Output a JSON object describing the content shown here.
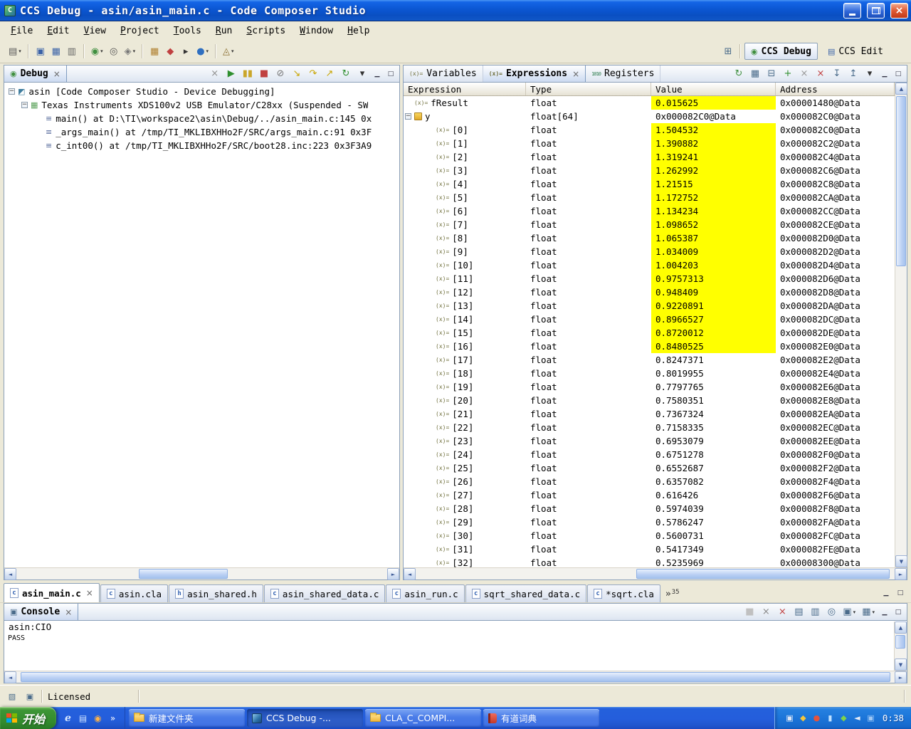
{
  "window": {
    "title": "CCS Debug - asin/asin_main.c - Code Composer Studio"
  },
  "menu": {
    "items": [
      "File",
      "Edit",
      "View",
      "Project",
      "Tools",
      "Run",
      "Scripts",
      "Window",
      "Help"
    ]
  },
  "main_toolbar": {
    "items": [
      {
        "name": "new-button",
        "glyph": "▤",
        "color": "#5a5a5a",
        "dd": true
      },
      {
        "sep": true
      },
      {
        "name": "save-button",
        "glyph": "▣",
        "color": "#3a62a8"
      },
      {
        "name": "save-all-button",
        "glyph": "▦",
        "color": "#3a62a8"
      },
      {
        "name": "print-button",
        "glyph": "▥",
        "color": "#666666"
      },
      {
        "sep": true
      },
      {
        "name": "debug-button",
        "glyph": "◉",
        "color": "#3f8f3f",
        "dd": true
      },
      {
        "name": "connect-target-button",
        "glyph": "◎",
        "color": "#555555"
      },
      {
        "name": "target-config-button",
        "glyph": "◈",
        "color": "#777777",
        "dd": true
      },
      {
        "sep": true
      },
      {
        "name": "memory-button",
        "glyph": "▦",
        "color": "#b08030"
      },
      {
        "name": "flash-button",
        "glyph": "◆",
        "color": "#c04040"
      },
      {
        "name": "terminal-button",
        "glyph": "▸",
        "color": "#333333"
      },
      {
        "name": "profile-button",
        "glyph": "●",
        "color": "#2f6fc0",
        "dd": true
      },
      {
        "sep": true
      },
      {
        "name": "search-button",
        "glyph": "◬",
        "color": "#8a6d2f",
        "dd": true
      }
    ]
  },
  "perspective_bar": {
    "debug_label": "CCS Debug",
    "edit_label": "CCS Edit"
  },
  "debug_view": {
    "tab_label": "Debug",
    "tools": [
      {
        "name": "remove-all-terminated-button",
        "glyph": "×",
        "color": "#909090"
      },
      {
        "name": "resume-button",
        "glyph": "▶",
        "color": "#2f8f2f"
      },
      {
        "name": "suspend-button",
        "glyph": "▮▮",
        "color": "#caa62a"
      },
      {
        "name": "terminate-button",
        "glyph": "■",
        "color": "#c04040"
      },
      {
        "name": "disconnect-button",
        "glyph": "⊘",
        "color": "#777777"
      },
      {
        "name": "step-into-button",
        "glyph": "↘",
        "color": "#c8a400"
      },
      {
        "name": "step-over-button",
        "glyph": "↷",
        "color": "#c8a400"
      },
      {
        "name": "step-return-button",
        "glyph": "↗",
        "color": "#c8a400"
      },
      {
        "name": "restart-button",
        "glyph": "↻",
        "color": "#2f8f2f"
      },
      {
        "name": "view-menu-button",
        "glyph": "▾",
        "color": "#333333"
      }
    ],
    "tree": [
      {
        "level": 0,
        "expander": true,
        "icon": "target",
        "label": "asin [Code Composer Studio - Device Debugging]"
      },
      {
        "level": 1,
        "expander": true,
        "icon": "device",
        "label": "Texas Instruments XDS100v2 USB Emulator/C28xx (Suspended - SW"
      },
      {
        "level": 2,
        "expander": false,
        "icon": "frame",
        "label": "main() at D:\\TI\\workspace2\\asin\\Debug/../asin_main.c:145 0x"
      },
      {
        "level": 2,
        "expander": false,
        "icon": "frame",
        "label": "_args_main() at /tmp/TI_MKLIBXHHo2F/SRC/args_main.c:91 0x3F"
      },
      {
        "level": 2,
        "expander": false,
        "icon": "frame",
        "label": "c_int00() at /tmp/TI_MKLIBXHHo2F/SRC/boot28.inc:223 0x3F3A9"
      }
    ]
  },
  "expressions_view": {
    "tabs": [
      {
        "label": "Variables",
        "icon": "vars",
        "active": false
      },
      {
        "label": "Expressions",
        "icon": "exprs",
        "active": true,
        "closable": true
      },
      {
        "label": "Registers",
        "icon": "regs",
        "active": false
      }
    ],
    "tools": [
      {
        "name": "refresh-button",
        "glyph": "↻",
        "color": "#3f8f3f"
      },
      {
        "name": "show-types-button",
        "glyph": "▦",
        "color": "#4a6b8a"
      },
      {
        "name": "collapse-all-button",
        "glyph": "⊟",
        "color": "#4a6b8a"
      },
      {
        "name": "add-expression-button",
        "glyph": "+",
        "color": "#2f8f2f"
      },
      {
        "name": "remove-expression-button",
        "glyph": "×",
        "color": "#999999"
      },
      {
        "name": "remove-all-expressions-button",
        "glyph": "×",
        "color": "#c04040"
      },
      {
        "name": "import-button",
        "glyph": "↧",
        "color": "#4a6b8a"
      },
      {
        "name": "export-button",
        "glyph": "↥",
        "color": "#4a6b8a"
      },
      {
        "name": "view-menu-button",
        "glyph": "▾",
        "color": "#333333"
      }
    ],
    "columns": [
      "Expression",
      "Type",
      "Value",
      "Address"
    ],
    "rows": [
      {
        "k": "var",
        "e": "fResult",
        "t": "float",
        "v": "0.015625",
        "a": "0x00001480@Data",
        "h": true
      },
      {
        "k": "array",
        "e": "y",
        "t": "float[64]",
        "v": "0x000082C0@Data",
        "a": "0x000082C0@Data",
        "h": false
      },
      {
        "k": "elem",
        "e": "[0]",
        "t": "float",
        "v": "1.504532",
        "a": "0x000082C0@Data",
        "h": true
      },
      {
        "k": "elem",
        "e": "[1]",
        "t": "float",
        "v": "1.390882",
        "a": "0x000082C2@Data",
        "h": true
      },
      {
        "k": "elem",
        "e": "[2]",
        "t": "float",
        "v": "1.319241",
        "a": "0x000082C4@Data",
        "h": true
      },
      {
        "k": "elem",
        "e": "[3]",
        "t": "float",
        "v": "1.262992",
        "a": "0x000082C6@Data",
        "h": true
      },
      {
        "k": "elem",
        "e": "[4]",
        "t": "float",
        "v": "1.21515",
        "a": "0x000082C8@Data",
        "h": true
      },
      {
        "k": "elem",
        "e": "[5]",
        "t": "float",
        "v": "1.172752",
        "a": "0x000082CA@Data",
        "h": true
      },
      {
        "k": "elem",
        "e": "[6]",
        "t": "float",
        "v": "1.134234",
        "a": "0x000082CC@Data",
        "h": true
      },
      {
        "k": "elem",
        "e": "[7]",
        "t": "float",
        "v": "1.098652",
        "a": "0x000082CE@Data",
        "h": true
      },
      {
        "k": "elem",
        "e": "[8]",
        "t": "float",
        "v": "1.065387",
        "a": "0x000082D0@Data",
        "h": true
      },
      {
        "k": "elem",
        "e": "[9]",
        "t": "float",
        "v": "1.034009",
        "a": "0x000082D2@Data",
        "h": true
      },
      {
        "k": "elem",
        "e": "[10]",
        "t": "float",
        "v": "1.004203",
        "a": "0x000082D4@Data",
        "h": true
      },
      {
        "k": "elem",
        "e": "[11]",
        "t": "float",
        "v": "0.9757313",
        "a": "0x000082D6@Data",
        "h": true
      },
      {
        "k": "elem",
        "e": "[12]",
        "t": "float",
        "v": "0.948409",
        "a": "0x000082D8@Data",
        "h": true
      },
      {
        "k": "elem",
        "e": "[13]",
        "t": "float",
        "v": "0.9220891",
        "a": "0x000082DA@Data",
        "h": true
      },
      {
        "k": "elem",
        "e": "[14]",
        "t": "float",
        "v": "0.8966527",
        "a": "0x000082DC@Data",
        "h": true
      },
      {
        "k": "elem",
        "e": "[15]",
        "t": "float",
        "v": "0.8720012",
        "a": "0x000082DE@Data",
        "h": true
      },
      {
        "k": "elem",
        "e": "[16]",
        "t": "float",
        "v": "0.8480525",
        "a": "0x000082E0@Data",
        "h": true
      },
      {
        "k": "elem",
        "e": "[17]",
        "t": "float",
        "v": "0.8247371",
        "a": "0x000082E2@Data",
        "h": false
      },
      {
        "k": "elem",
        "e": "[18]",
        "t": "float",
        "v": "0.8019955",
        "a": "0x000082E4@Data",
        "h": false
      },
      {
        "k": "elem",
        "e": "[19]",
        "t": "float",
        "v": "0.7797765",
        "a": "0x000082E6@Data",
        "h": false
      },
      {
        "k": "elem",
        "e": "[20]",
        "t": "float",
        "v": "0.7580351",
        "a": "0x000082E8@Data",
        "h": false
      },
      {
        "k": "elem",
        "e": "[21]",
        "t": "float",
        "v": "0.7367324",
        "a": "0x000082EA@Data",
        "h": false
      },
      {
        "k": "elem",
        "e": "[22]",
        "t": "float",
        "v": "0.7158335",
        "a": "0x000082EC@Data",
        "h": false
      },
      {
        "k": "elem",
        "e": "[23]",
        "t": "float",
        "v": "0.6953079",
        "a": "0x000082EE@Data",
        "h": false
      },
      {
        "k": "elem",
        "e": "[24]",
        "t": "float",
        "v": "0.6751278",
        "a": "0x000082F0@Data",
        "h": false
      },
      {
        "k": "elem",
        "e": "[25]",
        "t": "float",
        "v": "0.6552687",
        "a": "0x000082F2@Data",
        "h": false
      },
      {
        "k": "elem",
        "e": "[26]",
        "t": "float",
        "v": "0.6357082",
        "a": "0x000082F4@Data",
        "h": false
      },
      {
        "k": "elem",
        "e": "[27]",
        "t": "float",
        "v": "0.616426",
        "a": "0x000082F6@Data",
        "h": false
      },
      {
        "k": "elem",
        "e": "[28]",
        "t": "float",
        "v": "0.5974039",
        "a": "0x000082F8@Data",
        "h": false
      },
      {
        "k": "elem",
        "e": "[29]",
        "t": "float",
        "v": "0.5786247",
        "a": "0x000082FA@Data",
        "h": false
      },
      {
        "k": "elem",
        "e": "[30]",
        "t": "float",
        "v": "0.5600731",
        "a": "0x000082FC@Data",
        "h": false
      },
      {
        "k": "elem",
        "e": "[31]",
        "t": "float",
        "v": "0.5417349",
        "a": "0x000082FE@Data",
        "h": false
      },
      {
        "k": "elem",
        "e": "[32]",
        "t": "float",
        "v": "0.5235969",
        "a": "0x00008300@Data",
        "h": false
      }
    ]
  },
  "editor_area": {
    "tabs": [
      {
        "label": "asin_main.c",
        "icon": "c",
        "active": true,
        "closable": true
      },
      {
        "label": "asin.cla",
        "icon": "c",
        "active": false
      },
      {
        "label": "asin_shared.h",
        "icon": "h",
        "active": false
      },
      {
        "label": "asin_shared_data.c",
        "icon": "c",
        "active": false
      },
      {
        "label": "asin_run.c",
        "icon": "c",
        "active": false
      },
      {
        "label": "sqrt_shared_data.c",
        "icon": "c",
        "active": false
      },
      {
        "label": "*sqrt.cla",
        "icon": "c",
        "active": false
      }
    ],
    "overflow_count": "35"
  },
  "console_view": {
    "tab_label": "Console",
    "process_label": "asin:CIO",
    "output": "PASS",
    "tools": [
      {
        "name": "terminate-console-button",
        "glyph": "■",
        "color": "#c0c0c0"
      },
      {
        "name": "remove-launch-button",
        "glyph": "×",
        "color": "#8a8a8a"
      },
      {
        "name": "remove-all-launches-button",
        "glyph": "×",
        "color": "#c04040"
      },
      {
        "name": "clear-console-button",
        "glyph": "▤",
        "color": "#4a6b8a"
      },
      {
        "name": "scroll-lock-button",
        "glyph": "▥",
        "color": "#4a6b8a"
      },
      {
        "name": "pin-console-button",
        "glyph": "◎",
        "color": "#4a6b8a"
      },
      {
        "name": "display-console-button",
        "glyph": "▣",
        "color": "#4a6b8a",
        "dd": true
      },
      {
        "name": "open-console-button",
        "glyph": "▦",
        "color": "#4a6b8a",
        "dd": true
      }
    ]
  },
  "status_bar": {
    "licensed_label": "Licensed"
  },
  "taskbar": {
    "start_label": "开始",
    "quick_launch": [
      {
        "name": "ie-quicklaunch-icon",
        "glyph": "e",
        "color": "#d8e8ff",
        "ie": true
      },
      {
        "name": "show-desktop-icon",
        "glyph": "▤",
        "color": "#cfe3ff"
      },
      {
        "name": "media-player-icon",
        "glyph": "◉",
        "color": "#ffb347"
      },
      {
        "name": "quicklaunch-overflow-icon",
        "glyph": "»",
        "color": "#ffffff"
      }
    ],
    "tasks": [
      {
        "label": "新建文件夹",
        "icon": "folder",
        "active": false
      },
      {
        "label": "CCS Debug -...",
        "icon": "ccs",
        "active": true
      },
      {
        "label": "CLA_C_COMPI...",
        "icon": "folder",
        "active": false
      },
      {
        "label": "有道词典",
        "icon": "dict",
        "active": false
      }
    ],
    "tray_icons": [
      {
        "name": "tray-ime-icon",
        "glyph": "▣",
        "color": "#dfe7f5"
      },
      {
        "name": "tray-update-icon",
        "glyph": "◆",
        "color": "#f5c63c"
      },
      {
        "name": "tray-antivirus-icon",
        "glyph": "●",
        "color": "#e5533c"
      },
      {
        "name": "tray-network-icon",
        "glyph": "▮",
        "color": "#bfe0ff"
      },
      {
        "name": "tray-safety-icon",
        "glyph": "◆",
        "color": "#7fd24a"
      },
      {
        "name": "tray-volume-icon",
        "glyph": "◄",
        "color": "#e8eef8"
      },
      {
        "name": "tray-display-icon",
        "glyph": "▣",
        "color": "#9fc8f5"
      }
    ],
    "clock": "0:38"
  }
}
